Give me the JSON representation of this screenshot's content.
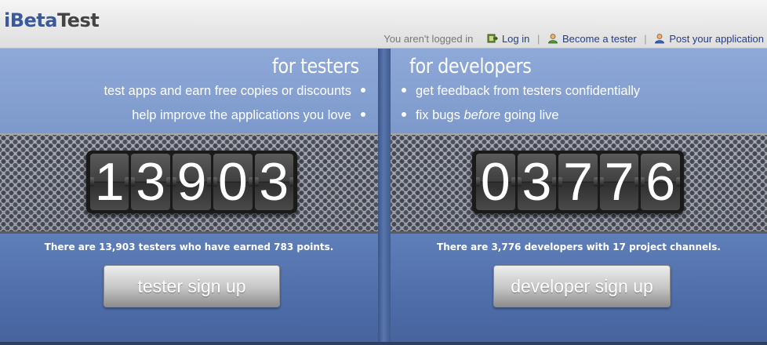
{
  "header": {
    "logo": {
      "i": "i",
      "beta": "Beta",
      "test": "Test"
    },
    "status_text": "You aren't logged in",
    "nav": [
      {
        "label": "Log in",
        "icon": "login-icon"
      },
      {
        "label": "Become a tester",
        "icon": "tester-user-icon"
      },
      {
        "label": "Post your application",
        "icon": "developer-user-icon"
      }
    ],
    "separator": "|"
  },
  "testers": {
    "heading": "for testers",
    "bullets": [
      "test apps and earn free copies or discounts",
      "help improve the applications you love"
    ],
    "counter": [
      "1",
      "3",
      "9",
      "0",
      "3"
    ],
    "stats": "There are 13,903 testers who have earned 783 points.",
    "signup_label": "tester sign up"
  },
  "developers": {
    "heading": "for developers",
    "bullets": [
      {
        "text": "get feedback from testers confidentially"
      },
      {
        "before": "fix bugs ",
        "emphasis": "before",
        "after": " going live"
      }
    ],
    "counter": [
      "0",
      "3",
      "7",
      "7",
      "6"
    ],
    "stats": "There are 3,776 developers with 17 project channels.",
    "signup_label": "developer sign up"
  },
  "colors": {
    "brand_blue": "#3a5a9c",
    "link": "#243c8c",
    "panel_top": "#8ea9d8",
    "panel_bottom": "#4c6aa6"
  }
}
